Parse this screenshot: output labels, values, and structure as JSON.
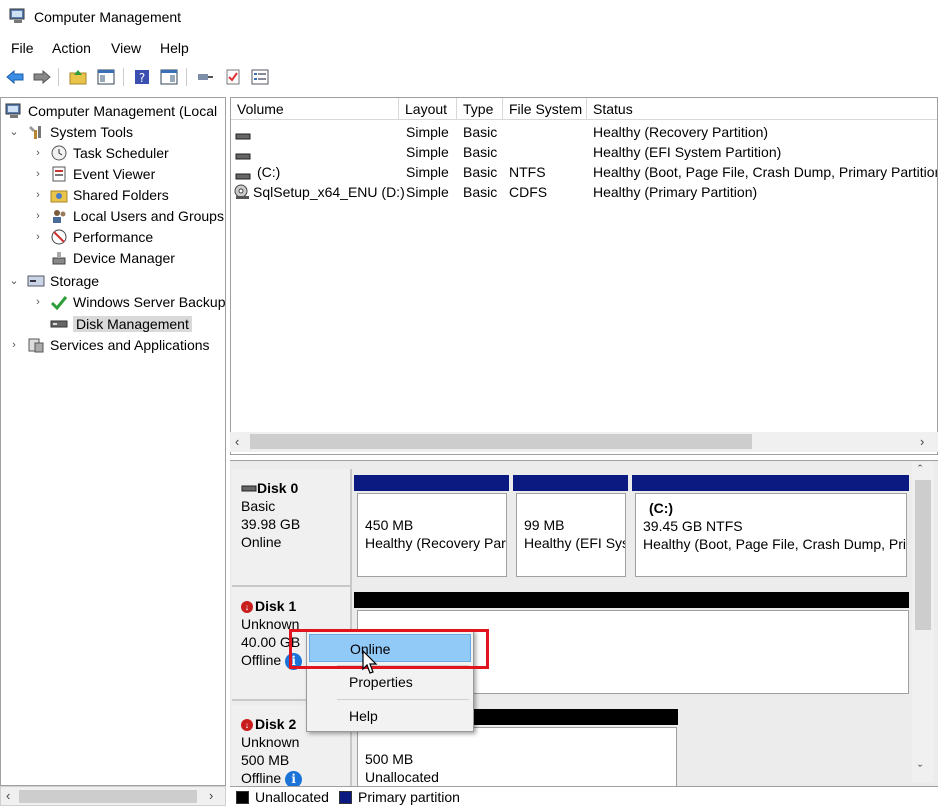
{
  "window": {
    "title": "Computer Management"
  },
  "menu": [
    "File",
    "Action",
    "View",
    "Help"
  ],
  "tree": {
    "root": "Computer Management (Local",
    "system_tools": "System Tools",
    "task_scheduler": "Task Scheduler",
    "event_viewer": "Event Viewer",
    "shared_folders": "Shared Folders",
    "local_users": "Local Users and Groups",
    "performance": "Performance",
    "device_manager": "Device Manager",
    "storage": "Storage",
    "wsb": "Windows Server Backup",
    "disk_management": "Disk Management",
    "services": "Services and Applications"
  },
  "volume_list": {
    "columns": [
      "Volume",
      "Layout",
      "Type",
      "File System",
      "Status"
    ],
    "rows": [
      {
        "volume": "",
        "layout": "Simple",
        "type": "Basic",
        "fs": "",
        "status": "Healthy (Recovery Partition)"
      },
      {
        "volume": "",
        "layout": "Simple",
        "type": "Basic",
        "fs": "",
        "status": "Healthy (EFI System Partition)"
      },
      {
        "volume": "(C:)",
        "layout": "Simple",
        "type": "Basic",
        "fs": "NTFS",
        "status": "Healthy (Boot, Page File, Crash Dump, Primary Partition"
      },
      {
        "volume": "SqlSetup_x64_ENU (D:)",
        "layout": "Simple",
        "type": "Basic",
        "fs": "CDFS",
        "status": "Healthy (Primary Partition)"
      }
    ]
  },
  "disks": {
    "disk0": {
      "name": "Disk 0",
      "type": "Basic",
      "size": "39.98 GB",
      "state": "Online",
      "parts": [
        {
          "label": "",
          "size": "450 MB",
          "status": "Healthy (Recovery Part"
        },
        {
          "label": "",
          "size": "99 MB",
          "status": "Healthy (EFI Syst"
        },
        {
          "label": "(C:)",
          "size": "39.45 GB NTFS",
          "status": "Healthy (Boot, Page File, Crash Dump, Pri"
        }
      ]
    },
    "disk1": {
      "name": "Disk 1",
      "type": "Unknown",
      "size": "40.00 GB",
      "state": "Offline"
    },
    "disk2": {
      "name": "Disk 2",
      "type": "Unknown",
      "size": "500 MB",
      "state": "Offline",
      "part": {
        "size": "500 MB",
        "status": "Unallocated"
      }
    }
  },
  "context_menu": {
    "online": "Online",
    "properties": "Properties",
    "help": "Help"
  },
  "legend": {
    "unallocated": "Unallocated",
    "primary": "Primary partition"
  },
  "colors": {
    "primary_partition": "#0a1a80",
    "unallocated": "#000000",
    "highlight_box": "#e0141e",
    "menu_hover": "#91c9f7"
  }
}
